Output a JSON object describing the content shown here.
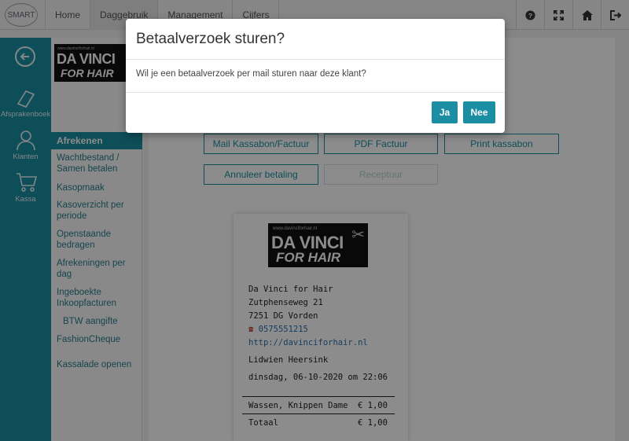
{
  "app": {
    "logo_text": "SMART",
    "colors": {
      "accent": "#1b8ea3",
      "overlay": "rgba(0,0,0,0.45)"
    }
  },
  "topnav": {
    "items": [
      {
        "label": "Home"
      },
      {
        "label": "Daggebruik"
      },
      {
        "label": "Management"
      },
      {
        "label": "Cijfers"
      }
    ],
    "icons": [
      "help-icon",
      "fullscreen-icon",
      "home-icon",
      "logout-icon"
    ]
  },
  "rail": {
    "items": [
      {
        "label": "Afsprakenboek",
        "icon": "book-icon"
      },
      {
        "label": "Klanten",
        "icon": "person-icon"
      },
      {
        "label": "Kassa",
        "icon": "cart-icon"
      }
    ]
  },
  "brand": {
    "url": "www.davinciforhair.nl",
    "line1": "DA VINCI",
    "line2": "FOR HAIR"
  },
  "submenu": {
    "active": "Afrekenen",
    "items": [
      {
        "label": "Wachtbestand / Samen betalen"
      },
      {
        "label": "Kasopmaak"
      },
      {
        "label": "Kasoverzicht per periode"
      },
      {
        "label": "Openstaande bedragen"
      },
      {
        "label": "Afrekeningen per dag"
      },
      {
        "label": "Ingeboekte Inkoopfacturen"
      },
      {
        "label": "BTW aangifte"
      },
      {
        "label": "FashionCheque"
      },
      {
        "label": "Kassalade openen"
      }
    ]
  },
  "actions": {
    "mail": "Mail Kassabon/Factuur",
    "pdf": "PDF Factuur",
    "print": "Print kassabon",
    "cancel": "Annuleer betaling",
    "recipe": "Receptuur"
  },
  "receipt": {
    "shop_name": "Da Vinci for Hair",
    "street": "Zutphenseweg 21",
    "city": "7251 DG Vorden",
    "phone": "0575551215",
    "website": "http://davinciforhair.nl",
    "employee": "Lidwien Heersink",
    "datetime": "dinsdag, 06-10-2020 om 22:06",
    "line_item": {
      "desc": "Wassen, Knippen Dame",
      "amount": "€ 1,00"
    },
    "total": {
      "label": "Totaal",
      "amount": "€ 1,00"
    }
  },
  "modal": {
    "title": "Betaalverzoek sturen?",
    "body": "Wil je een betaalverzoek per mail sturen naar deze klant?",
    "yes": "Ja",
    "no": "Nee"
  }
}
